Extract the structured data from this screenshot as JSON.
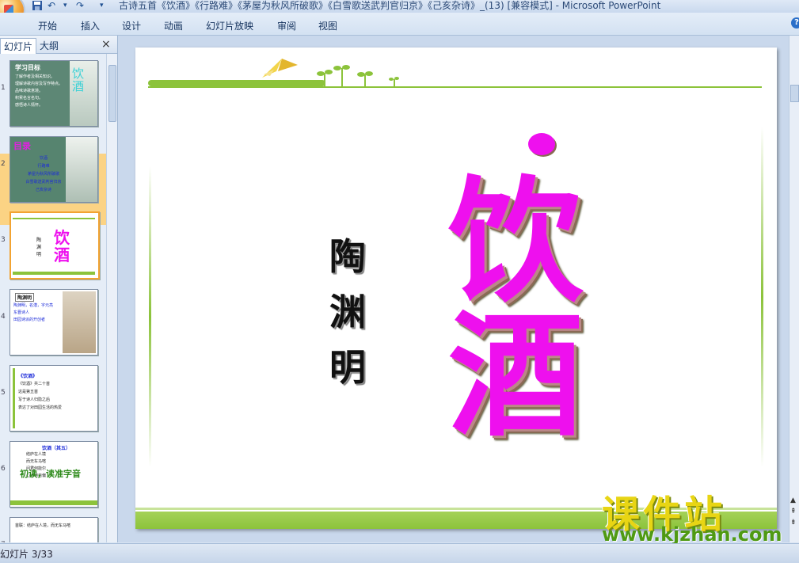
{
  "window": {
    "title": "古诗五首《饮酒》《行路难》《茅屋为秋风所破歌》《白雪歌送武判官归京》《己亥杂诗》_(13) [兼容模式] - Microsoft PowerPoint"
  },
  "ribbon": {
    "tabs": [
      "开始",
      "插入",
      "设计",
      "动画",
      "幻灯片放映",
      "审阅",
      "视图"
    ],
    "help": "?"
  },
  "panel": {
    "tab_slides": "幻灯片",
    "tab_outline": "大纲",
    "close": "×"
  },
  "thumbnails": [
    {
      "num": "1",
      "title": "学习目标",
      "side": "饮酒",
      "lines": [
        "了解作者及相关知识。",
        "理解诗歌内容及写作特点。",
        "品味诗歌意境。",
        "积累名言名句。",
        "感悟诗人情怀。"
      ]
    },
    {
      "num": "2",
      "title": "目录",
      "lines": [
        "饮酒",
        "行路难",
        "茅屋为秋风所破歌",
        "白雪歌送武判官归京",
        "己亥杂诗"
      ]
    },
    {
      "num": "3",
      "title": "饮酒",
      "author": "陶渊明"
    },
    {
      "num": "4",
      "title": "陶渊明",
      "lines": [
        "陶渊明，名潜，字元亮",
        "东晋诗人",
        "田园诗派的开创者"
      ]
    },
    {
      "num": "5",
      "title": "《饮酒》",
      "lines": [
        "《饮酒》共二十首",
        "这是第五首",
        "写于诗人归隐之后",
        "表达了对田园生活的热爱"
      ]
    },
    {
      "num": "6",
      "title": "饮酒（其五）",
      "lines": [
        "结庐在人境",
        "而无车马喧",
        "问君何能尔",
        "心远地自偏"
      ],
      "overlay": "初读，读准字音"
    },
    {
      "num": "7",
      "lines": [
        "首联：结庐在人境，而无车马喧"
      ]
    }
  ],
  "slide": {
    "title_chars": [
      "饮",
      "酒"
    ],
    "author_chars": [
      "陶",
      "渊",
      "明"
    ]
  },
  "watermark": {
    "cn": "课件站",
    "url": "www.kjzhan.com"
  },
  "status": {
    "text": "幻灯片 3/33"
  },
  "colors": {
    "title_magenta": "#ee10ee",
    "green_band": "#8cc33b"
  }
}
